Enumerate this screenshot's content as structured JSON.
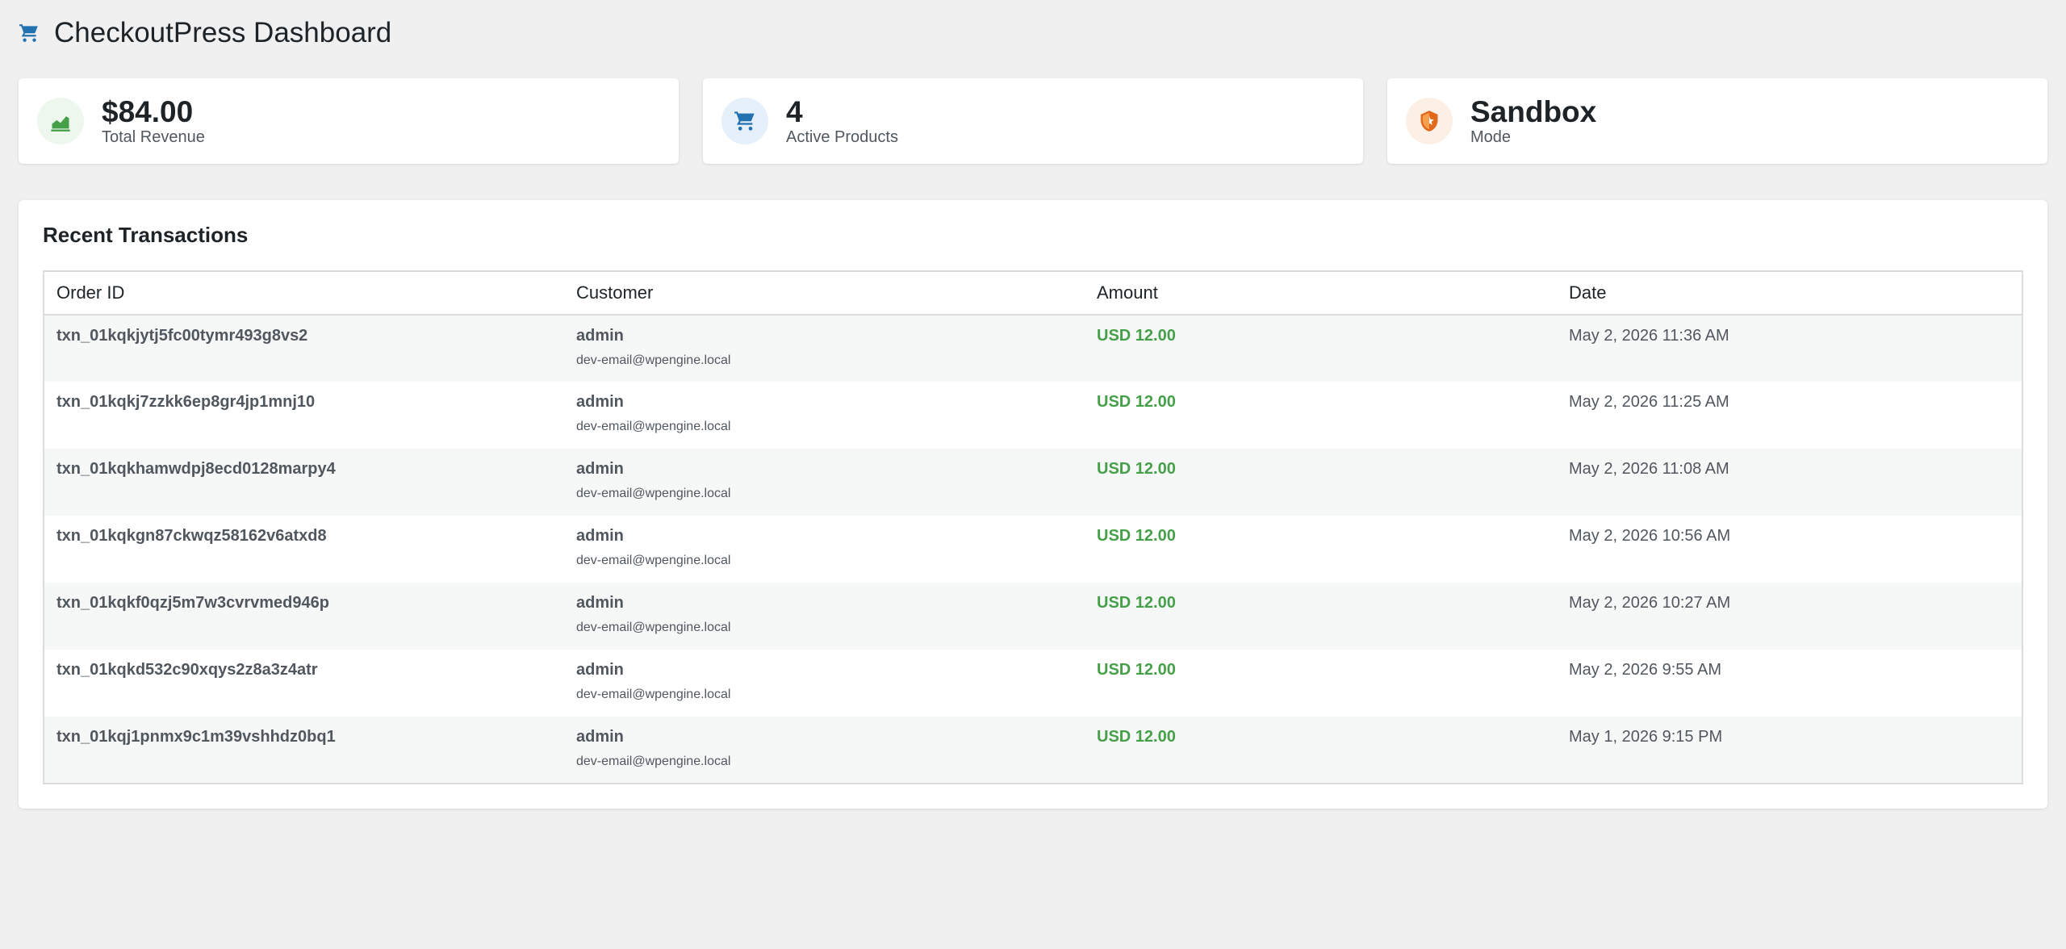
{
  "header": {
    "icon": "cart-icon",
    "title": "CheckoutPress Dashboard"
  },
  "stats": [
    {
      "icon": "chart-icon",
      "value": "$84.00",
      "label": "Total Revenue",
      "icon_color": "#46a049",
      "icon_bg": "#edf7ee"
    },
    {
      "icon": "cart-icon",
      "value": "4",
      "label": "Active Products",
      "icon_color": "#2271b1",
      "icon_bg": "#e6f0fa"
    },
    {
      "icon": "shield-icon",
      "value": "Sandbox",
      "label": "Mode",
      "icon_color": "#d63638",
      "icon_bg": "#fcf0e6"
    }
  ],
  "transactions": {
    "title": "Recent Transactions",
    "columns": [
      "Order ID",
      "Customer",
      "Amount",
      "Date"
    ],
    "rows": [
      {
        "order_id": "txn_01kqkjytj5fc00tymr493g8vs2",
        "customer": "admin",
        "email": "dev-email@wpengine.local",
        "amount": "USD 12.00",
        "date": "May 2, 2026 11:36 AM"
      },
      {
        "order_id": "txn_01kqkj7zzkk6ep8gr4jp1mnj10",
        "customer": "admin",
        "email": "dev-email@wpengine.local",
        "amount": "USD 12.00",
        "date": "May 2, 2026 11:25 AM"
      },
      {
        "order_id": "txn_01kqkhamwdpj8ecd0128marpy4",
        "customer": "admin",
        "email": "dev-email@wpengine.local",
        "amount": "USD 12.00",
        "date": "May 2, 2026 11:08 AM"
      },
      {
        "order_id": "txn_01kqkgn87ckwqz58162v6atxd8",
        "customer": "admin",
        "email": "dev-email@wpengine.local",
        "amount": "USD 12.00",
        "date": "May 2, 2026 10:56 AM"
      },
      {
        "order_id": "txn_01kqkf0qzj5m7w3cvrvmed946p",
        "customer": "admin",
        "email": "dev-email@wpengine.local",
        "amount": "USD 12.00",
        "date": "May 2, 2026 10:27 AM"
      },
      {
        "order_id": "txn_01kqkd532c90xqys2z8a3z4atr",
        "customer": "admin",
        "email": "dev-email@wpengine.local",
        "amount": "USD 12.00",
        "date": "May 2, 2026 9:55 AM"
      },
      {
        "order_id": "txn_01kqj1pnmx9c1m39vshhdz0bq1",
        "customer": "admin",
        "email": "dev-email@wpengine.local",
        "amount": "USD 12.00",
        "date": "May 1, 2026 9:15 PM"
      }
    ]
  }
}
